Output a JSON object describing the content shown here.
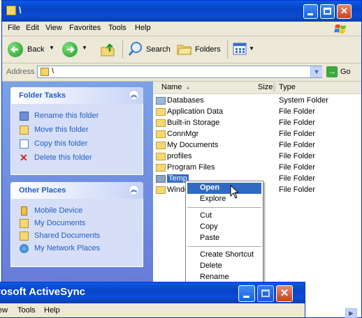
{
  "explorer": {
    "title": "\\",
    "menu": [
      "File",
      "Edit",
      "View",
      "Favorites",
      "Tools",
      "Help"
    ],
    "toolbar": {
      "back": "Back",
      "search": "Search",
      "folders": "Folders"
    },
    "address": {
      "label": "Address",
      "value": "\\",
      "go": "Go"
    }
  },
  "taskpane": {
    "folder_tasks": {
      "title": "Folder Tasks",
      "items": [
        {
          "label": "Rename this folder",
          "icon": "rename-icon"
        },
        {
          "label": "Move this folder",
          "icon": "move-icon"
        },
        {
          "label": "Copy this folder",
          "icon": "copy-icon"
        },
        {
          "label": "Delete this folder",
          "icon": "delete-icon"
        }
      ]
    },
    "other_places": {
      "title": "Other Places",
      "items": [
        {
          "label": "Mobile Device",
          "icon": "mobile-device-icon"
        },
        {
          "label": "My Documents",
          "icon": "my-documents-icon"
        },
        {
          "label": "Shared Documents",
          "icon": "shared-documents-icon"
        },
        {
          "label": "My Network Places",
          "icon": "network-places-icon"
        }
      ]
    }
  },
  "filelist": {
    "columns": {
      "name": "Name",
      "size": "Size",
      "type": "Type"
    },
    "rows": [
      {
        "name": "Databases",
        "type": "System Folder"
      },
      {
        "name": "Application Data",
        "type": "File Folder"
      },
      {
        "name": "Built-in Storage",
        "type": "File Folder"
      },
      {
        "name": "ConnMgr",
        "type": "File Folder"
      },
      {
        "name": "My Documents",
        "type": "File Folder"
      },
      {
        "name": "profiles",
        "type": "File Folder"
      },
      {
        "name": "Program Files",
        "type": "File Folder"
      },
      {
        "name": "Temp",
        "type": "File Folder"
      },
      {
        "name": "Windo",
        "type": "File Folder"
      }
    ]
  },
  "context_menu": {
    "items": [
      "Open",
      "Explore",
      "Cut",
      "Copy",
      "Paste",
      "Create Shortcut",
      "Delete",
      "Rename"
    ]
  },
  "activesync": {
    "title": "rosoft ActiveSync",
    "menu": [
      "ew",
      "Tools",
      "Help"
    ]
  }
}
